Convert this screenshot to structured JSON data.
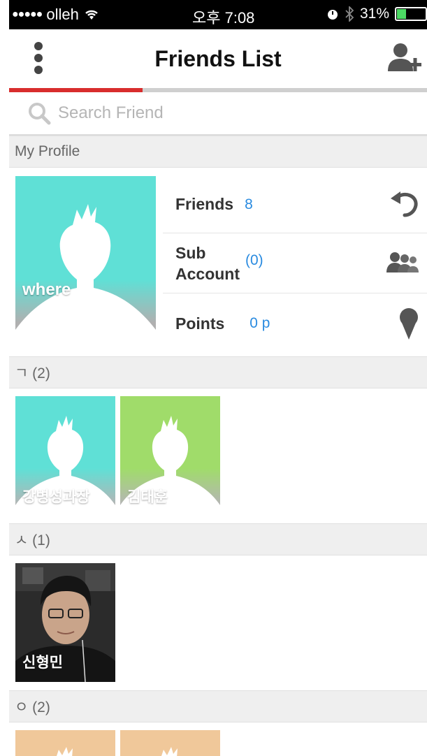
{
  "status_bar": {
    "carrier": "olleh",
    "time": "오후 7:08",
    "battery": "31%"
  },
  "nav": {
    "title": "Friends List",
    "tab_progress": 0.32
  },
  "search": {
    "placeholder": "Search Friend"
  },
  "profile": {
    "header": "My Profile",
    "name": "where",
    "stats": [
      {
        "label": "Friends",
        "value": "8",
        "icon": "refresh-icon"
      },
      {
        "label": "Sub Account",
        "value": "(0)",
        "icon": "group-icon"
      },
      {
        "label": "Points",
        "value": "0 p",
        "icon": "ice-cream-icon"
      }
    ]
  },
  "sections": [
    {
      "header": "ㄱ (2)",
      "friends": [
        {
          "name": "강병성과장",
          "color": "#5fe0d6"
        },
        {
          "name": "김태훈",
          "color": "#a0dc6a"
        }
      ]
    },
    {
      "header": "ㅅ (1)",
      "friends": [
        {
          "name": "신형민",
          "color": "#2a2a2a",
          "photo": true
        }
      ]
    },
    {
      "header": "ㅇ (2)",
      "friends": [
        {
          "name": "",
          "color": "#f0c89a"
        },
        {
          "name": "",
          "color": "#f0c89a"
        }
      ]
    }
  ],
  "colors": {
    "accent": "#2a8be0",
    "tab_indicator": "#d82d2d"
  }
}
